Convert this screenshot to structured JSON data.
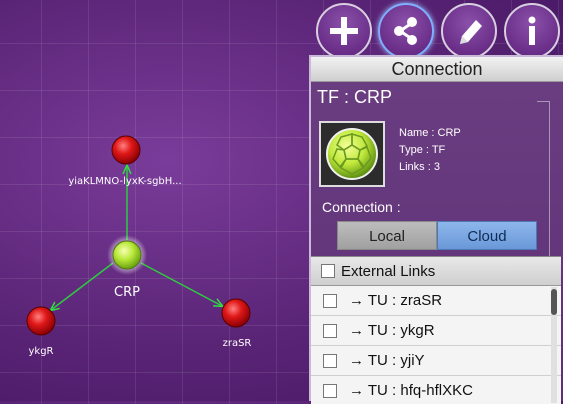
{
  "graph": {
    "center_label": "CRP",
    "nodes": [
      {
        "label": "yiaKLMNO-lyxK-sgbH..."
      },
      {
        "label": "ykgR"
      },
      {
        "label": "zraSR"
      }
    ]
  },
  "toolbar": {
    "add_icon": "plus-icon",
    "share_icon": "share-icon",
    "edit_icon": "pencil-icon",
    "info_icon": "info-icon"
  },
  "panel": {
    "title": "Connection",
    "heading": "TF : CRP",
    "name": "Name : CRP",
    "type": "Type : TF",
    "links": "Links : 3",
    "connection_label": "Connection :",
    "local_label": "Local",
    "cloud_label": "Cloud",
    "external_header": "External Links",
    "external_links": [
      "→ TU : zraSR",
      "→ TU : ykgR",
      "→ TU : yjiY",
      "→ TU : hfq-hflXKC"
    ]
  },
  "colors": {
    "background": "#5a2476",
    "node_red": "#d8141e",
    "node_center": "#b4e632",
    "edge": "#2ecc40",
    "cloud_selected": "#7aa6e2"
  }
}
